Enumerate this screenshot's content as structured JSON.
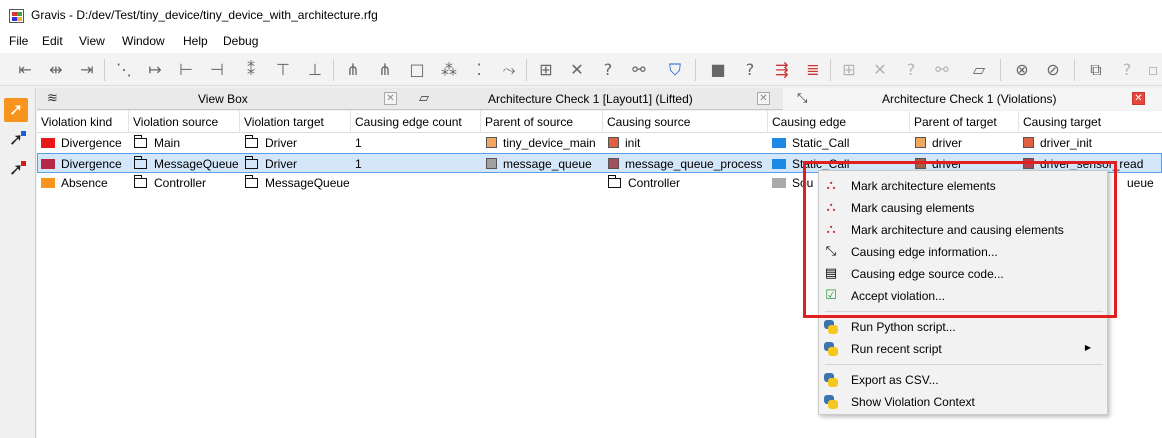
{
  "window": {
    "title": "Gravis - D:/dev/Test/tiny_device/tiny_device_with_architecture.rfg"
  },
  "menubar": [
    "File",
    "Edit",
    "View",
    "Window",
    "Help",
    "Debug"
  ],
  "tabs": [
    {
      "title": "View Box"
    },
    {
      "title": "Architecture Check 1 [Layout1] (Lifted)"
    },
    {
      "title": "Architecture Check 1 (Violations)"
    }
  ],
  "table": {
    "headers": [
      "Violation kind",
      "Violation source",
      "Violation target",
      "Causing edge count",
      "Parent of source",
      "Causing source",
      "Causing edge",
      "Parent of target",
      "Causing target"
    ],
    "rows": [
      {
        "kind": "Divergence",
        "kind_color": "#e81818",
        "source": "Main",
        "target": "Driver",
        "count": "1",
        "parent_source": "tiny_device_main",
        "parent_source_color": "#f0a860",
        "causing_source": "init",
        "causing_source_color": "#e06040",
        "edge": "Static_Call",
        "edge_color": "#1e88e5",
        "parent_target": "driver",
        "parent_target_color": "#f0a860",
        "causing_target": "driver_init",
        "causing_target_color": "#e06040"
      },
      {
        "kind": "Divergence",
        "kind_color": "#b42848",
        "source": "MessageQueue",
        "target": "Driver",
        "count": "1",
        "parent_source": "message_queue",
        "parent_source_color": "#a0a0a0",
        "causing_source": "message_queue_process",
        "causing_source_color": "#a05060",
        "edge": "Static_Call",
        "edge_color": "#1e88e5",
        "parent_target": "driver",
        "parent_target_color": "#a06048",
        "causing_target": "driver_sensor_read",
        "causing_target_color": "#b04050"
      },
      {
        "kind": "Absence",
        "kind_color": "#f7941d",
        "source": "Controller",
        "target": "MessageQueue",
        "count": "",
        "causing_source": "Controller",
        "edge": "Sou",
        "edge_color": "#aaaaaa",
        "causing_target": "ueue"
      }
    ]
  },
  "context_menu": {
    "items": [
      {
        "label": "Mark architecture elements",
        "icon": "mark-architecture-icon"
      },
      {
        "label": "Mark causing elements",
        "icon": "mark-causing-icon"
      },
      {
        "label": "Mark architecture and causing elements",
        "icon": "mark-both-icon"
      },
      {
        "label": "Causing edge information...",
        "icon": "edge-info-icon"
      },
      {
        "label": "Causing edge source code...",
        "icon": "document-icon"
      },
      {
        "label": "Accept violation...",
        "icon": "checkbox-checked-icon"
      },
      {
        "label": "Run Python script...",
        "icon": "python-icon"
      },
      {
        "label": "Run recent script",
        "icon": "python-icon",
        "submenu_arrow": "▶"
      },
      {
        "label": "Export as CSV...",
        "icon": "python-icon"
      },
      {
        "label": "Show Violation Context",
        "icon": "python-icon"
      }
    ]
  },
  "colors": {
    "accent": "#f7941d",
    "selection": "#d3e6fa",
    "highlight": "#e02020"
  }
}
